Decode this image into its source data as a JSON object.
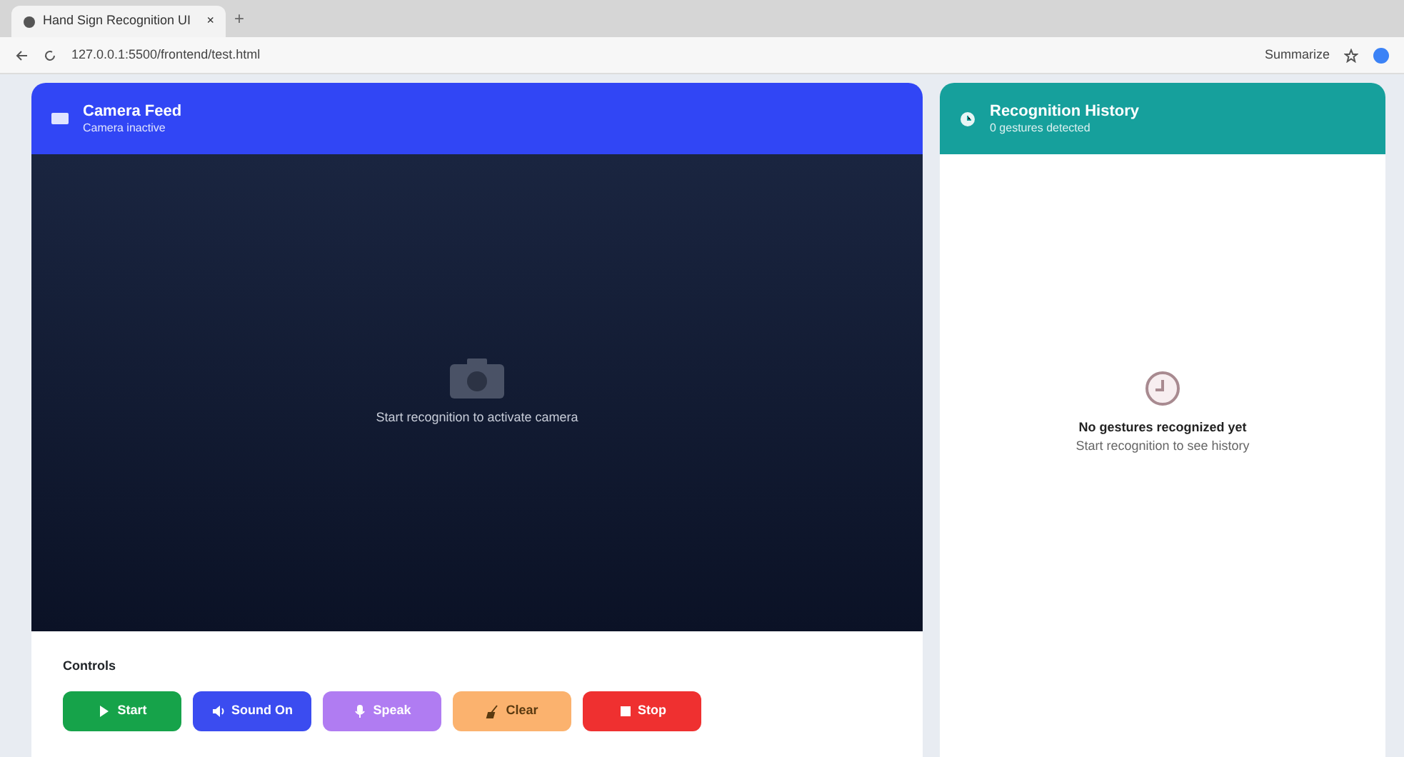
{
  "browser": {
    "tab_title": "Hand Sign Recognition UI",
    "tab_close": "×",
    "new_tab": "+",
    "url": "127.0.0.1:5500/frontend/test.html",
    "summarize": "Summarize"
  },
  "camera": {
    "title": "Camera Feed",
    "subtitle": "Camera inactive",
    "message": "Start recognition to activate camera"
  },
  "history": {
    "title": "Recognition History",
    "subtitle": "0 gestures detected",
    "empty_title": "No gestures recognized yet",
    "empty_hint": "Start recognition to see history"
  },
  "controls": {
    "title": "Controls",
    "buttons": [
      {
        "kind": "start",
        "label": "Start",
        "color": "#16a34a"
      },
      {
        "kind": "sound",
        "label": "Sound On",
        "color": "#3b4cf0"
      },
      {
        "kind": "speak",
        "label": "Speak",
        "color": "#b07cf2"
      },
      {
        "kind": "clear",
        "label": "Clear",
        "color": "#fbb26e"
      },
      {
        "kind": "stop",
        "label": "Stop",
        "color": "#ef3030"
      }
    ]
  }
}
